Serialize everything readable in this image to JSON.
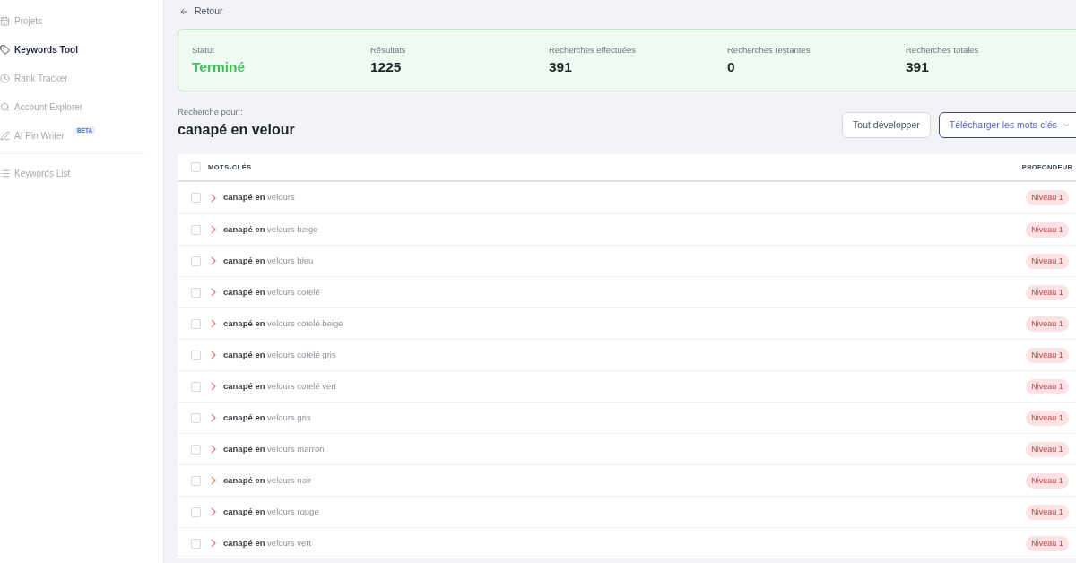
{
  "sidebar": {
    "items": [
      {
        "label": "Projets",
        "selected": false
      },
      {
        "label": "Keywords Tool",
        "selected": true
      },
      {
        "label": "Rank Tracker",
        "selected": false
      },
      {
        "label": "Account Explorer",
        "selected": false
      },
      {
        "label": "AI Pin Writer",
        "selected": false,
        "badge": "BETA"
      }
    ],
    "secondary_items": [
      {
        "label": "Keywords List",
        "selected": false
      }
    ]
  },
  "back_link": "Retour",
  "stats": [
    {
      "kind": "status",
      "label": "Statut",
      "value": "Terminé"
    },
    {
      "kind": "count",
      "label": "Résultats",
      "value": "1225"
    },
    {
      "kind": "count",
      "label": "Recherches effectuées",
      "value": "391"
    },
    {
      "kind": "count",
      "label": "Recherches restantes",
      "value": "0"
    },
    {
      "kind": "count",
      "label": "Recherches totales",
      "value": "391"
    }
  ],
  "search": {
    "label": "Recherche pour :",
    "query": "canapé en velour"
  },
  "actions": {
    "expand_all": "Tout développer",
    "download": "Télécharger les mots-clés"
  },
  "table": {
    "select_all_checked": false,
    "columns": [
      "MOTS-CLÉS",
      "PROFONDEUR"
    ],
    "rows": [
      {
        "keyword": "**canapé en** velours",
        "depth": "Niveau 1",
        "checked": false,
        "expanded": false
      },
      {
        "keyword": "**canapé en** velours beige",
        "depth": "Niveau 1",
        "checked": false,
        "expanded": false
      },
      {
        "keyword": "**canapé en** velours bleu",
        "depth": "Niveau 1",
        "checked": false,
        "expanded": false
      },
      {
        "keyword": "**canapé en** velours cotelé",
        "depth": "Niveau 1",
        "checked": false,
        "expanded": false
      },
      {
        "keyword": "**canapé en** velours cotelé beige",
        "depth": "Niveau 1",
        "checked": false,
        "expanded": false
      },
      {
        "keyword": "**canapé en** velours cotelé gris",
        "depth": "Niveau 1",
        "checked": false,
        "expanded": false
      },
      {
        "keyword": "**canapé en** velours cotelé vert",
        "depth": "Niveau 1",
        "checked": false,
        "expanded": false
      },
      {
        "keyword": "**canapé en** velours gris",
        "depth": "Niveau 1",
        "checked": false,
        "expanded": false
      },
      {
        "keyword": "**canapé en** velours marron",
        "depth": "Niveau 1",
        "checked": false,
        "expanded": false
      },
      {
        "keyword": "**canapé en** velours noir",
        "depth": "Niveau 1",
        "checked": false,
        "expanded": false
      },
      {
        "keyword": "**canapé en** velours rouge",
        "depth": "Niveau 1",
        "checked": false,
        "expanded": false
      },
      {
        "keyword": "**canapé en** velours vert",
        "depth": "Niveau 1",
        "checked": false,
        "expanded": false
      }
    ]
  }
}
